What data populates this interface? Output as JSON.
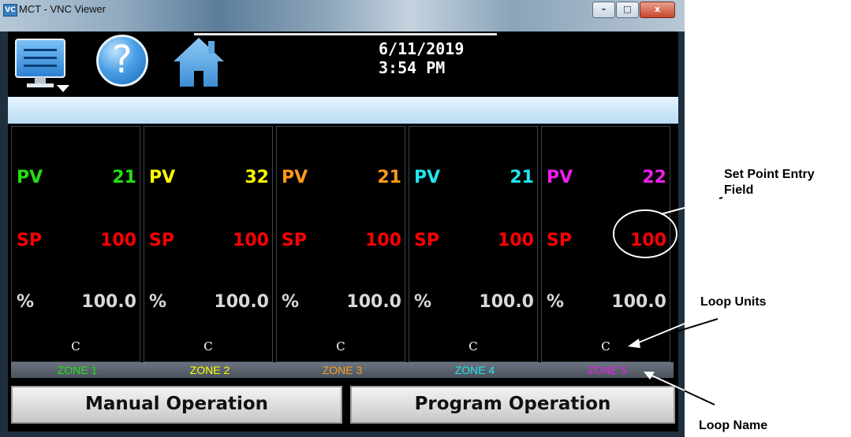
{
  "window": {
    "title": "MCT - VNC Viewer",
    "icon_text": "VC",
    "min": "–",
    "max": "□",
    "close": "x"
  },
  "header": {
    "date": "6/11/2019",
    "time": "3:54 PM"
  },
  "zones": [
    {
      "pv_label": "PV",
      "pv": "21",
      "sp_label": "SP",
      "sp": "100",
      "pct_label": "%",
      "pct": "100.0",
      "unit": "C",
      "name": "ZONE 1",
      "color": "#22e010"
    },
    {
      "pv_label": "PV",
      "pv": "32",
      "sp_label": "SP",
      "sp": "100",
      "pct_label": "%",
      "pct": "100.0",
      "unit": "C",
      "name": "ZONE 2",
      "color": "#ffff00"
    },
    {
      "pv_label": "PV",
      "pv": "21",
      "sp_label": "SP",
      "sp": "100",
      "pct_label": "%",
      "pct": "100.0",
      "unit": "C",
      "name": "ZONE 3",
      "color": "#ff9a1a"
    },
    {
      "pv_label": "PV",
      "pv": "21",
      "sp_label": "SP",
      "sp": "100",
      "pct_label": "%",
      "pct": "100.0",
      "unit": "C",
      "name": "ZONE 4",
      "color": "#1fe6ee"
    },
    {
      "pv_label": "PV",
      "pv": "22",
      "sp_label": "SP",
      "sp": "100",
      "pct_label": "%",
      "pct": "100.0",
      "unit": "C",
      "name": "ZONE 5",
      "color": "#ee1eee"
    }
  ],
  "buttons": {
    "manual": "Manual Operation",
    "program": "Program Operation"
  },
  "callouts": {
    "set_point_1": "Set Point Entry",
    "set_point_2": "Field",
    "loop_units": "Loop Units",
    "loop_name": "Loop Name"
  },
  "icons": {
    "menu": "monitor-menu-icon",
    "help": "help-icon",
    "home": "home-icon"
  }
}
